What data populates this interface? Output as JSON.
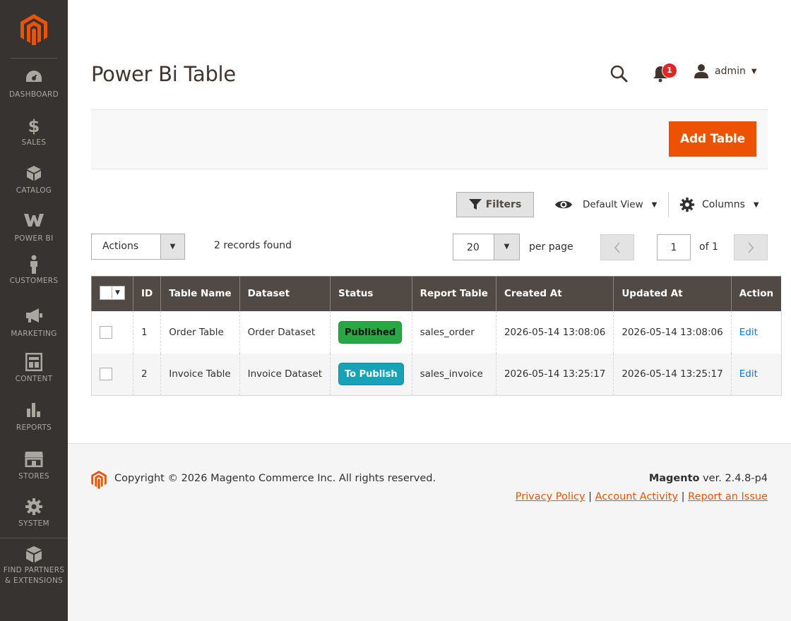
{
  "sidebar": {
    "items": [
      {
        "label": "Dashboard",
        "icon": "dashboard-icon"
      },
      {
        "label": "Sales",
        "icon": "dollar-icon"
      },
      {
        "label": "Catalog",
        "icon": "box-icon"
      },
      {
        "label": "Power BI",
        "icon": "power-bi-icon"
      },
      {
        "label": "Customers",
        "icon": "person-icon"
      },
      {
        "label": "Marketing",
        "icon": "megaphone-icon"
      },
      {
        "label": "Content",
        "icon": "content-icon"
      },
      {
        "label": "Reports",
        "icon": "bar-chart-icon"
      },
      {
        "label": "Stores",
        "icon": "store-icon"
      },
      {
        "label": "System",
        "icon": "gear-icon"
      },
      {
        "label": "Find Partners",
        "label2": "& Extensions",
        "icon": "extensions-icon"
      }
    ]
  },
  "header": {
    "title": "Power Bi Table",
    "notification_count": "1",
    "user": "admin"
  },
  "toolbar": {
    "add_button": "Add Table"
  },
  "grid_controls": {
    "filters": "Filters",
    "default_view": "Default View",
    "columns": "Columns",
    "actions": "Actions",
    "records_found": "2 records found",
    "per_page_value": "20",
    "per_page_label": "per page",
    "page_value": "1",
    "page_of": "of 1"
  },
  "table": {
    "columns": [
      "ID",
      "Table Name",
      "Dataset",
      "Status",
      "Report Table",
      "Created At",
      "Updated At",
      "Action"
    ],
    "rows": [
      {
        "id": "1",
        "name": "Order Table",
        "dataset": "Order Dataset",
        "status": "Published",
        "report_table": "sales_order",
        "created": "2026-05-14 13:08:06",
        "updated": "2026-05-14 13:08:06",
        "action": "Edit"
      },
      {
        "id": "2",
        "name": "Invoice Table",
        "dataset": "Invoice Dataset",
        "status": "To Publish",
        "report_table": "sales_invoice",
        "created": "2026-05-14 13:25:17",
        "updated": "2026-05-14 13:25:17",
        "action": "Edit"
      }
    ]
  },
  "footer": {
    "copyright": "Copyright © 2026 Magento Commerce Inc. All rights reserved.",
    "brand": "Magento",
    "version": " ver. 2.4.8-p4",
    "links": [
      "Privacy Policy",
      "Account Activity",
      "Report an Issue"
    ]
  },
  "colors": {
    "sidebar_bg": "#373330",
    "accent": "#eb5202",
    "table_header": "#514943",
    "published": "#28a745",
    "to_publish": "#17a2b8"
  }
}
